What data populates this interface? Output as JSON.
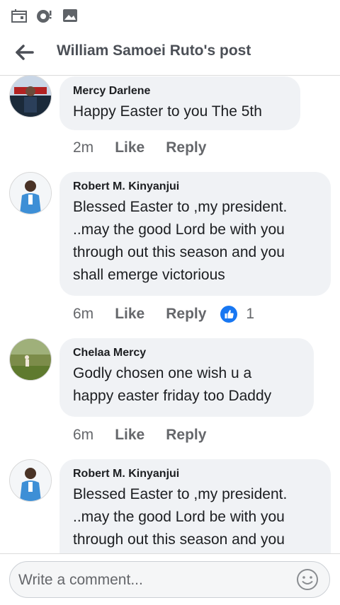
{
  "status_bar": {
    "icons": [
      "calendar-icon",
      "camera-notification-icon",
      "gallery-icon"
    ]
  },
  "header": {
    "back_icon": "arrow-left-icon",
    "title": "William Samoei Ruto's post"
  },
  "comments": [
    {
      "author": "Mercy Darlene",
      "text": "Happy Easter to you The 5th",
      "time": "2m",
      "like_label": "Like",
      "reply_label": "Reply"
    },
    {
      "author": "Robert M. Kinyanjui",
      "lines": [
        "Blessed Easter to ,my president.",
        "..may the good Lord be with you",
        "through out this season and you",
        "shall emerge victorious"
      ],
      "time": "6m",
      "like_label": "Like",
      "reply_label": "Reply",
      "reaction_icon": "like-reaction-icon",
      "reaction_count": "1"
    },
    {
      "author": "Chelaa Mercy",
      "lines": [
        "Godly chosen one wish u a",
        "happy easter friday too Daddy"
      ],
      "time": "6m",
      "like_label": "Like",
      "reply_label": "Reply"
    },
    {
      "author": "Robert M. Kinyanjui",
      "lines": [
        "Blessed Easter to ,my president.",
        "..may the good Lord be with you",
        "through out this season and you"
      ]
    }
  ],
  "composer": {
    "placeholder": "Write a comment...",
    "emoji_icon": "smiley-icon"
  },
  "colors": {
    "bubble": "#f0f2f5",
    "text": "#1c1e21",
    "muted": "#65676b",
    "like_blue": "#1877f2"
  }
}
